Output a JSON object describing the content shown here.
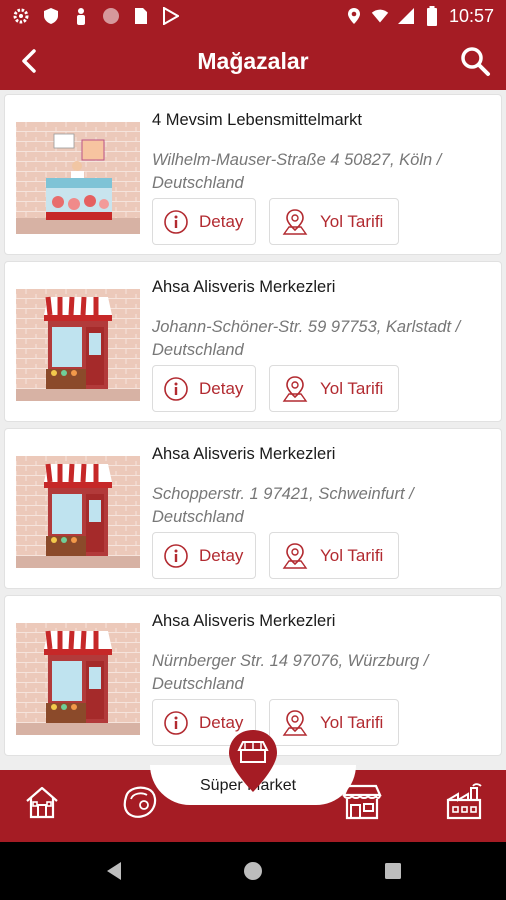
{
  "status_bar": {
    "time": "10:57",
    "left_icons": [
      "gear-icon",
      "shield-icon",
      "person-icon",
      "circle-icon",
      "sim-icon",
      "play-store-icon"
    ],
    "right_icons": [
      "location-icon",
      "wifi-icon",
      "signal-icon",
      "battery-icon"
    ]
  },
  "app_bar": {
    "title": "Mağazalar",
    "back_icon": "back-arrow-icon",
    "search_icon": "search-icon"
  },
  "stores": [
    {
      "name": "4 Mevsim Lebensmittelmarkt",
      "address": "Wilhelm-Mauser-Straße 4 50827, Köln / Deutschland",
      "image": "butcher-counter-illustration",
      "detail_label": "Detay",
      "route_label": "Yol Tarifi"
    },
    {
      "name": "Ahsa Alisveris Merkezleri",
      "address": "Johann-Schöner-Str. 59 97753, Karlstadt / Deutschland",
      "image": "shop-front-illustration",
      "detail_label": "Detay",
      "route_label": "Yol Tarifi"
    },
    {
      "name": "Ahsa Alisveris Merkezleri",
      "address": "Schopperstr. 1 97421, Schweinfurt / Deutschland",
      "image": "shop-front-illustration",
      "detail_label": "Detay",
      "route_label": "Yol Tarifi"
    },
    {
      "name": "Ahsa Alisveris Merkezleri",
      "address": "Nürnberger Str. 14 97076, Würzburg / Deutschland",
      "image": "shop-front-illustration",
      "detail_label": "Detay",
      "route_label": "Yol Tarifi"
    }
  ],
  "bottom_nav": {
    "center_label": "Süper Market",
    "items": [
      "home-icon",
      "meat-icon",
      "store-pin-icon",
      "market-stall-icon",
      "factory-icon"
    ]
  },
  "colors": {
    "brand": "#a51c24",
    "accent_text": "#b22a30",
    "address_text": "#777777"
  }
}
